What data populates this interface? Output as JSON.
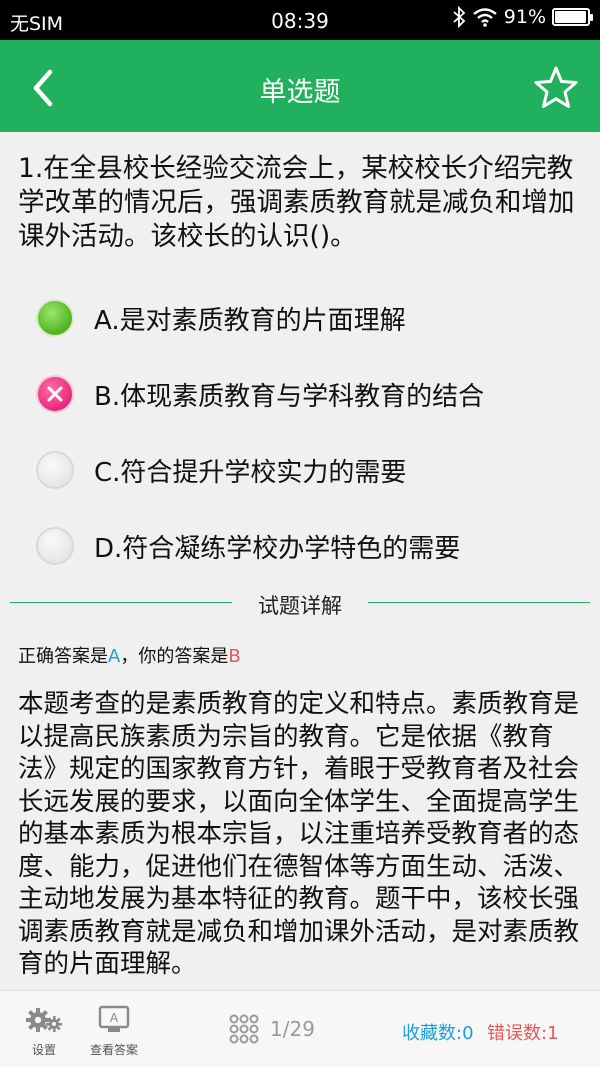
{
  "status_bar": {
    "carrier": "无SIM",
    "time": "08:39",
    "battery_text": "91%",
    "battery_level": 0.91
  },
  "header": {
    "title": "单选题",
    "back_icon": "chevron-left-icon",
    "favorite_icon": "star-outline-icon",
    "bg_color": "#20b05e"
  },
  "question": {
    "text": "1.在全县校长经验交流会上，某校校长介绍完教学改革的情况后，强调素质教育就是减负和增加课外活动。该校长的认识()。",
    "options": [
      {
        "label": "A.是对素质教育的片面理解",
        "state": "correct"
      },
      {
        "label": "B.体现素质教育与学科教育的结合",
        "state": "wrong"
      },
      {
        "label": "C.符合提升学校实力的需要",
        "state": "none"
      },
      {
        "label": "D.符合凝练学校办学特色的需要",
        "state": "none"
      }
    ]
  },
  "explanation": {
    "section_title": "试题详解",
    "answer_prefix": "正确答案是",
    "correct_answer": "A",
    "answer_middle": "，你的答案是",
    "user_answer": "B",
    "body": "本题考查的是素质教育的定义和特点。素质教育是以提高民族素质为宗旨的教育。它是依据《教育法》规定的国家教育方针，着眼于受教育者及社会长远发展的要求，以面向全体学生、全面提高学生的基本素质为根本宗旨，以注重培养受教育者的态度、能力，促进他们在德智体等方面生动、活泼、主动地发展为基本特征的教育。题干中，该校长强调素质教育就是减负和增加课外活动，是对素质教育的片面理解。"
  },
  "toolbar": {
    "settings_label": "设置",
    "view_answer_label": "查看答案",
    "page_indicator": "1/29",
    "favorites_label": "收藏数:0",
    "errors_label": "错误数:1",
    "colors": {
      "favorites": "#1a9fe0",
      "errors": "#e55656"
    }
  }
}
